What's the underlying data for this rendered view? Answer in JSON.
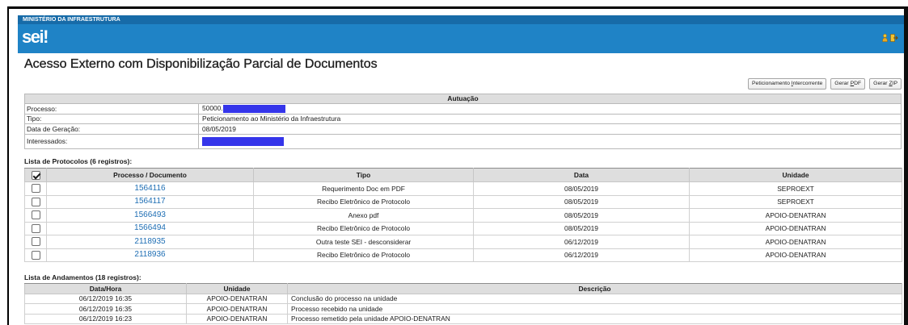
{
  "colors": {
    "header_bar": "#1f83c6",
    "header_strip": "#176ba8",
    "link": "#1e6eb4",
    "redaction": "#3535ea",
    "table_header": "#dedede",
    "icon_yellow": "#f2c230"
  },
  "header": {
    "org_name": "MINISTÉRIO DA INFRAESTRUTURA",
    "logo_text": "sei!",
    "icons": [
      "user-icon",
      "exit-icon"
    ]
  },
  "page_title": "Acesso Externo com Disponibilização Parcial de Documentos",
  "toolbar": {
    "peticionamento": {
      "before": "Peticionamento ",
      "key": "I",
      "after": "ntercorrente"
    },
    "gerar_pdf": {
      "before": "Gerar ",
      "key": "P",
      "after": "DF"
    },
    "gerar_zip": {
      "before": "Gerar ",
      "key": "Z",
      "after": "IP"
    }
  },
  "autuacao": {
    "title": "Autuação",
    "rows": [
      {
        "label": "Processo:",
        "value": "50000."
      },
      {
        "label": "Tipo:",
        "value": "Peticionamento ao Ministério da Infraestrutura"
      },
      {
        "label": "Data de Geração:",
        "value": "08/05/2019"
      },
      {
        "label": "Interessados:"
      }
    ]
  },
  "protocolos": {
    "caption": "Lista de Protocolos (6 registros):",
    "select_all_checked": true,
    "columns": [
      "Processo / Documento",
      "Tipo",
      "Data",
      "Unidade"
    ],
    "rows": [
      {
        "checked": false,
        "documento": "1564116",
        "tipo": "Requerimento Doc em PDF",
        "data": "08/05/2019",
        "unidade": "SEPROEXT"
      },
      {
        "checked": false,
        "documento": "1564117",
        "tipo": "Recibo Eletrônico de Protocolo",
        "data": "08/05/2019",
        "unidade": "SEPROEXT"
      },
      {
        "checked": false,
        "documento": "1566493",
        "tipo": "Anexo pdf",
        "data": "08/05/2019",
        "unidade": "APOIO-DENATRAN"
      },
      {
        "checked": false,
        "documento": "1566494",
        "tipo": "Recibo Eletrônico de Protocolo",
        "data": "08/05/2019",
        "unidade": "APOIO-DENATRAN"
      },
      {
        "checked": false,
        "documento": "2118935",
        "tipo": "Outra teste SEI - desconsiderar",
        "data": "06/12/2019",
        "unidade": "APOIO-DENATRAN"
      },
      {
        "checked": false,
        "documento": "2118936",
        "tipo": "Recibo Eletrônico de Protocolo",
        "data": "06/12/2019",
        "unidade": "APOIO-DENATRAN"
      }
    ]
  },
  "andamentos": {
    "caption": "Lista de Andamentos (18 registros):",
    "columns": [
      "Data/Hora",
      "Unidade",
      "Descrição"
    ],
    "rows": [
      {
        "data_hora": "06/12/2019 16:35",
        "unidade": "APOIO-DENATRAN",
        "descricao": "Conclusão do processo na unidade"
      },
      {
        "data_hora": "06/12/2019 16:35",
        "unidade": "APOIO-DENATRAN",
        "descricao": "Processo recebido na unidade"
      },
      {
        "data_hora": "06/12/2019 16:23",
        "unidade": "APOIO-DENATRAN",
        "descricao": "Processo remetido pela unidade APOIO-DENATRAN"
      }
    ]
  }
}
